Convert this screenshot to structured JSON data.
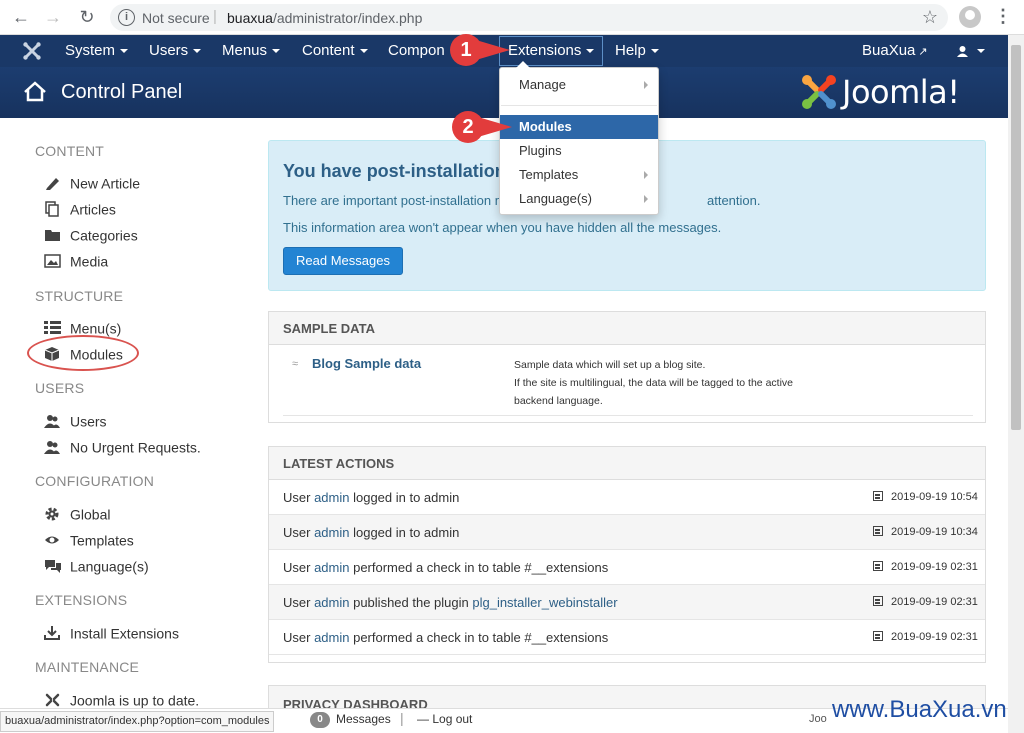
{
  "browser": {
    "security_label": "Not secure",
    "url_host": "buaxua",
    "url_path": "/administrator/index.php"
  },
  "topnav": {
    "items": [
      {
        "label": "System"
      },
      {
        "label": "Users"
      },
      {
        "label": "Menus"
      },
      {
        "label": "Content"
      },
      {
        "label": "Compon"
      },
      {
        "label": "Extensions"
      },
      {
        "label": "Help"
      }
    ],
    "site_link": "BuaXua"
  },
  "header": {
    "title": "Control Panel",
    "brand": "Joomla!"
  },
  "dropdown": {
    "items": [
      {
        "label": "Manage"
      },
      {
        "label": "Modules"
      },
      {
        "label": "Plugins"
      },
      {
        "label": "Templates"
      },
      {
        "label": "Language(s)"
      }
    ]
  },
  "callouts": [
    "1",
    "2"
  ],
  "sidebar": {
    "content": {
      "heading": "CONTENT",
      "items": [
        "New Article",
        "Articles",
        "Categories",
        "Media"
      ]
    },
    "structure": {
      "heading": "STRUCTURE",
      "items": [
        "Menu(s)",
        "Modules"
      ]
    },
    "users": {
      "heading": "USERS",
      "items": [
        "Users",
        "No Urgent Requests."
      ]
    },
    "configuration": {
      "heading": "CONFIGURATION",
      "items": [
        "Global",
        "Templates",
        "Language(s)"
      ]
    },
    "extensions": {
      "heading": "EXTENSIONS",
      "items": [
        "Install Extensions"
      ]
    },
    "maintenance": {
      "heading": "MAINTENANCE",
      "items": [
        "Joomla is up to date."
      ]
    }
  },
  "alert": {
    "title": "You have post-installation",
    "line1_a": "There are important post-installation m",
    "line1_b": "attention.",
    "line2": "This information area won't appear when you have hidden all the messages.",
    "button": "Read Messages"
  },
  "sample_data": {
    "heading": "SAMPLE DATA",
    "link": "Blog Sample data",
    "desc1": "Sample data which will set up a blog site.",
    "desc2": "If the site is multilingual, the data will be tagged to the active",
    "desc3": "backend language."
  },
  "latest_actions": {
    "heading": "LATEST ACTIONS",
    "rows": [
      {
        "pre": "User ",
        "user": "admin",
        "post": " logged in to admin",
        "link": "",
        "date": "2019-09-19 10:54"
      },
      {
        "pre": "User ",
        "user": "admin",
        "post": " logged in to admin",
        "link": "",
        "date": "2019-09-19 10:34"
      },
      {
        "pre": "User ",
        "user": "admin",
        "post": " performed a check in to table #__extensions",
        "link": "",
        "date": "2019-09-19 02:31"
      },
      {
        "pre": "User ",
        "user": "admin",
        "post": " published the plugin ",
        "link": "plg_installer_webinstaller",
        "date": "2019-09-19 02:31"
      },
      {
        "pre": "User ",
        "user": "admin",
        "post": " performed a check in to table #__extensions",
        "link": "",
        "date": "2019-09-19 02:31"
      }
    ]
  },
  "privacy": {
    "heading": "PRIVACY DASHBOARD"
  },
  "footer": {
    "status_url": "buaxua/administrator/index.php?option=com_modules",
    "messages_count": "0",
    "messages_label": "Messages",
    "logout": "Log out",
    "joomla_trunc": "Joo"
  },
  "watermark": "www.BuaXua.vn",
  "colors": {
    "nav_bg": "#1a3867",
    "active_item": "#2d67a8",
    "callout": "#e23c3c",
    "alert_bg": "#d9edf7",
    "button": "#2384d3"
  }
}
